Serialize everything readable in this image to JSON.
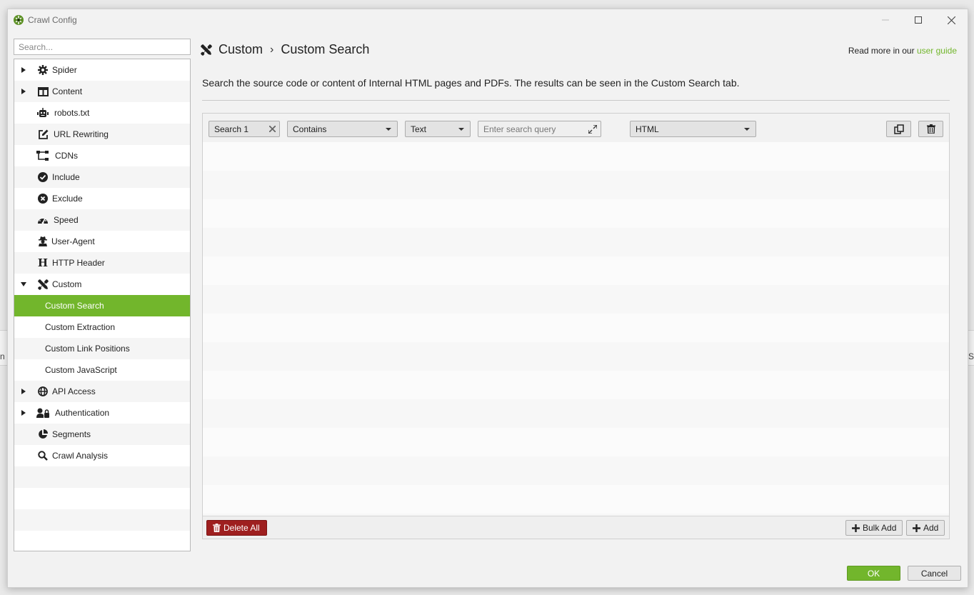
{
  "window": {
    "title": "Crawl Config"
  },
  "background": {
    "left_fragment": "n",
    "right_fragment": "Se"
  },
  "sidebar": {
    "search_placeholder": "Search...",
    "items": [
      {
        "label": "Spider",
        "icon": "gear-icon",
        "expandable": true
      },
      {
        "label": "Content",
        "icon": "columns-icon",
        "expandable": true
      },
      {
        "label": "robots.txt",
        "icon": "robot-icon",
        "expandable": false
      },
      {
        "label": "URL Rewriting",
        "icon": "edit-icon",
        "expandable": false
      },
      {
        "label": "CDNs",
        "icon": "network-icon",
        "expandable": false
      },
      {
        "label": "Include",
        "icon": "check-circle-icon",
        "expandable": false
      },
      {
        "label": "Exclude",
        "icon": "x-circle-icon",
        "expandable": false
      },
      {
        "label": "Speed",
        "icon": "speedometer-icon",
        "expandable": false
      },
      {
        "label": "User-Agent",
        "icon": "user-secret-icon",
        "expandable": false
      },
      {
        "label": "HTTP Header",
        "icon": "heading-icon",
        "expandable": false
      },
      {
        "label": "Custom",
        "icon": "tools-icon",
        "expandable": true,
        "expanded": true,
        "children": [
          {
            "label": "Custom Search",
            "selected": true
          },
          {
            "label": "Custom Extraction"
          },
          {
            "label": "Custom Link Positions"
          },
          {
            "label": "Custom JavaScript"
          }
        ]
      },
      {
        "label": "API Access",
        "icon": "globe-icon",
        "expandable": true
      },
      {
        "label": "Authentication",
        "icon": "user-lock-icon",
        "expandable": true
      },
      {
        "label": "Segments",
        "icon": "pie-chart-icon",
        "expandable": false
      },
      {
        "label": "Crawl Analysis",
        "icon": "search-icon",
        "expandable": false
      }
    ]
  },
  "header": {
    "breadcrumb_parent": "Custom",
    "breadcrumb_separator": "›",
    "breadcrumb_current": "Custom Search",
    "read_more_prefix": "Read more in our",
    "read_more_link": "user guide"
  },
  "description": "Search the source code or content of Internal HTML pages and PDFs. The results can be seen in the Custom Search tab.",
  "search_row": {
    "name": "Search 1",
    "mode": "Contains",
    "type": "Text",
    "query_placeholder": "Enter search query",
    "query_value": "",
    "scope": "HTML"
  },
  "footer": {
    "delete_all": "Delete All",
    "bulk_add": "Bulk Add",
    "add": "Add"
  },
  "dialog": {
    "ok": "OK",
    "cancel": "Cancel"
  },
  "colors": {
    "accent": "#72b62c",
    "danger": "#9e1f1f",
    "link": "#72b62c"
  }
}
